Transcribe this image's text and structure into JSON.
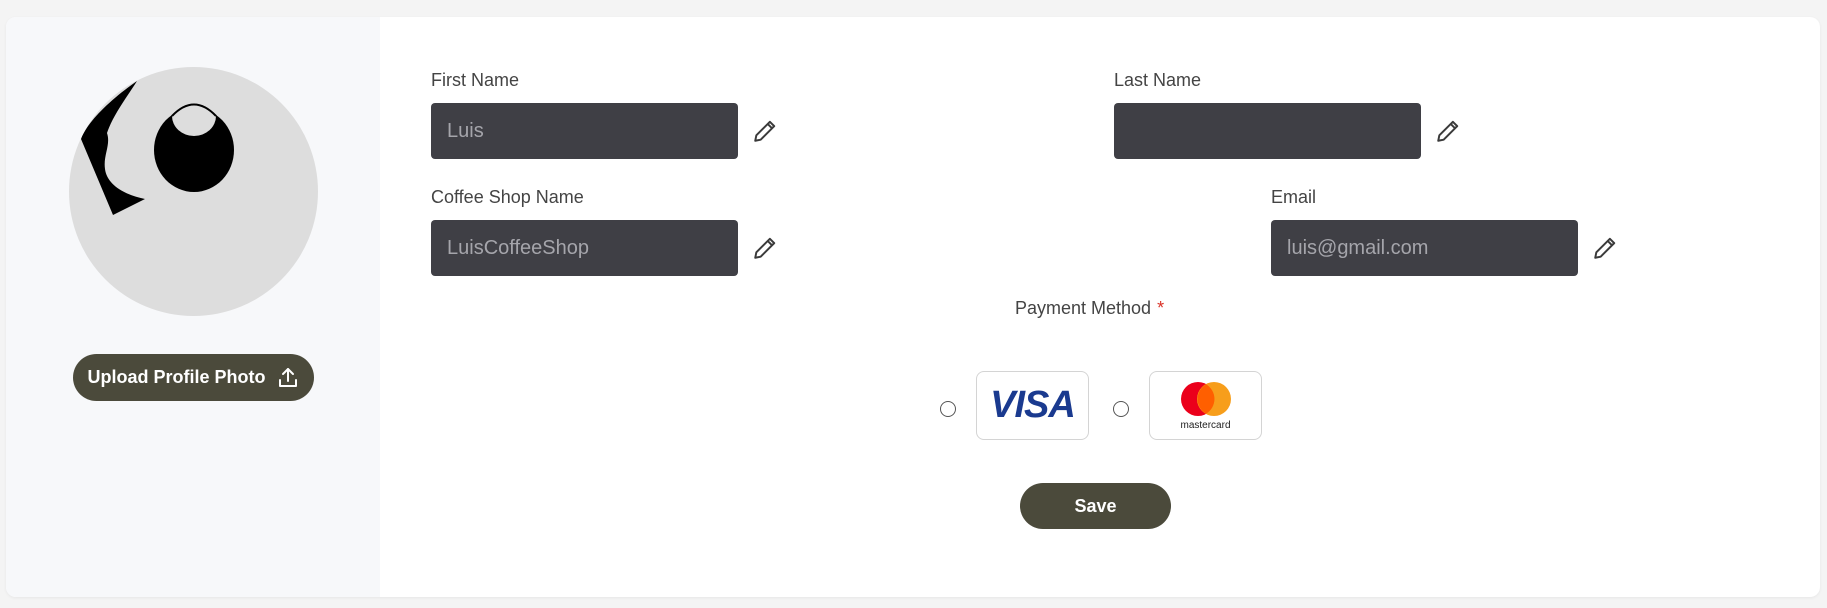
{
  "sidebar": {
    "upload_label": "Upload Profile Photo"
  },
  "form": {
    "first_name": {
      "label": "First Name",
      "value": "Luis"
    },
    "last_name": {
      "label": "Last Name",
      "value": ""
    },
    "coffee_shop_name": {
      "label": "Coffee Shop Name",
      "value": "LuisCoffeeShop"
    },
    "email": {
      "label": "Email",
      "value": "luis@gmail.com"
    }
  },
  "payment": {
    "label": "Payment Method",
    "required_mark": "*",
    "options": [
      {
        "brand": "VISA",
        "selected": false
      },
      {
        "brand": "mastercard",
        "selected": false
      }
    ]
  },
  "save_label": "Save",
  "colors": {
    "button_bg": "#4b4a3b",
    "input_bg": "#3f3f45",
    "sidebar_bg": "#f7f8fa",
    "required": "#d93025",
    "visa_blue": "#1a3a8f",
    "mc_red": "#eb001b",
    "mc_orange": "#f79e1b"
  },
  "icons": {
    "upload": "upload-icon",
    "edit": "pencil-icon"
  }
}
